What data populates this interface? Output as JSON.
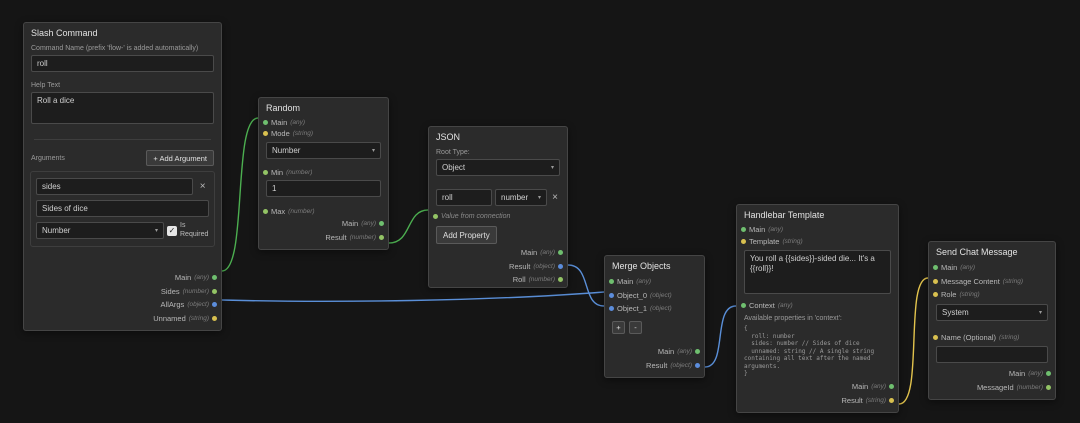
{
  "colors": {
    "wire_green": "#4caf50",
    "wire_blue": "#5a8fd8",
    "wire_yellow": "#e3c44d",
    "dot_any": "#6fbf6f",
    "dot_number": "#93c465",
    "dot_object": "#5c8ddb",
    "dot_string": "#d8c04f"
  },
  "icons": {
    "caret": "▾",
    "close": "×",
    "check": "✓",
    "plus": "+",
    "minus": "-"
  },
  "nodes": {
    "slash_command": {
      "title": "Slash Command",
      "command_name_label": "Command Name (prefix 'flow-' is added automatically)",
      "command_name_value": "roll",
      "help_text_label": "Help Text",
      "help_text_value": "Roll a dice",
      "arguments_label": "Arguments",
      "add_argument_button": "+ Add Argument",
      "argument": {
        "name_value": "sides",
        "description_value": "Sides of dice",
        "type_value": "Number",
        "is_required_label": "Is Required"
      },
      "outputs": [
        {
          "label": "Main",
          "type": "(any)"
        },
        {
          "label": "Sides",
          "type": "(number)"
        },
        {
          "label": "AllArgs",
          "type": "(object)"
        },
        {
          "label": "Unnamed",
          "type": "(string)"
        }
      ]
    },
    "random": {
      "title": "Random",
      "inputs": [
        {
          "label": "Main",
          "type": "(any)"
        },
        {
          "label": "Mode",
          "type": "(string)"
        }
      ],
      "mode_value": "Number",
      "min": {
        "label": "Min",
        "type": "(number)",
        "value": "1"
      },
      "max": {
        "label": "Max",
        "type": "(number)"
      },
      "outputs": [
        {
          "label": "Main",
          "type": "(any)"
        },
        {
          "label": "Result",
          "type": "(number)"
        }
      ]
    },
    "json": {
      "title": "JSON",
      "root_type_label": "Root Type:",
      "root_type_value": "Object",
      "property": {
        "key_value": "roll",
        "type_value": "number"
      },
      "value_from_connection": "Value from connection",
      "add_property_button": "Add Property",
      "outputs": [
        {
          "label": "Main",
          "type": "(any)"
        },
        {
          "label": "Result",
          "type": "(object)"
        },
        {
          "label": "Roll",
          "type": "(number)"
        }
      ]
    },
    "merge_objects": {
      "title": "Merge Objects",
      "inputs": [
        {
          "label": "Main",
          "type": "(any)"
        },
        {
          "label": "Object_0",
          "type": "(object)"
        },
        {
          "label": "Object_1",
          "type": "(object)"
        }
      ],
      "outputs": [
        {
          "label": "Main",
          "type": "(any)"
        },
        {
          "label": "Result",
          "type": "(object)"
        }
      ]
    },
    "handlebar_template": {
      "title": "Handlebar Template",
      "inputs": [
        {
          "label": "Main",
          "type": "(any)"
        },
        {
          "label": "Template",
          "type": "(string)"
        }
      ],
      "template_value": "You roll a {{sides}}-sided die... It's a {{roll}}!",
      "context": {
        "label": "Context",
        "type": "(any)"
      },
      "available_label": "Available properties in 'context':",
      "available_code": "{\n  roll: number\n  sides: number // Sides of dice\n  unnamed: string // A single string\ncontaining all text after the named arguments.\n}",
      "outputs": [
        {
          "label": "Main",
          "type": "(any)"
        },
        {
          "label": "Result",
          "type": "(string)"
        }
      ]
    },
    "send_chat_message": {
      "title": "Send Chat Message",
      "inputs": [
        {
          "label": "Main",
          "type": "(any)"
        },
        {
          "label": "Message Content",
          "type": "(string)"
        },
        {
          "label": "Role",
          "type": "(string)"
        }
      ],
      "role_value": "System",
      "name_field": {
        "label": "Name (Optional)",
        "type": "(string)",
        "value": ""
      },
      "outputs": [
        {
          "label": "Main",
          "type": "(any)"
        },
        {
          "label": "MessageId",
          "type": "(number)"
        }
      ]
    }
  }
}
